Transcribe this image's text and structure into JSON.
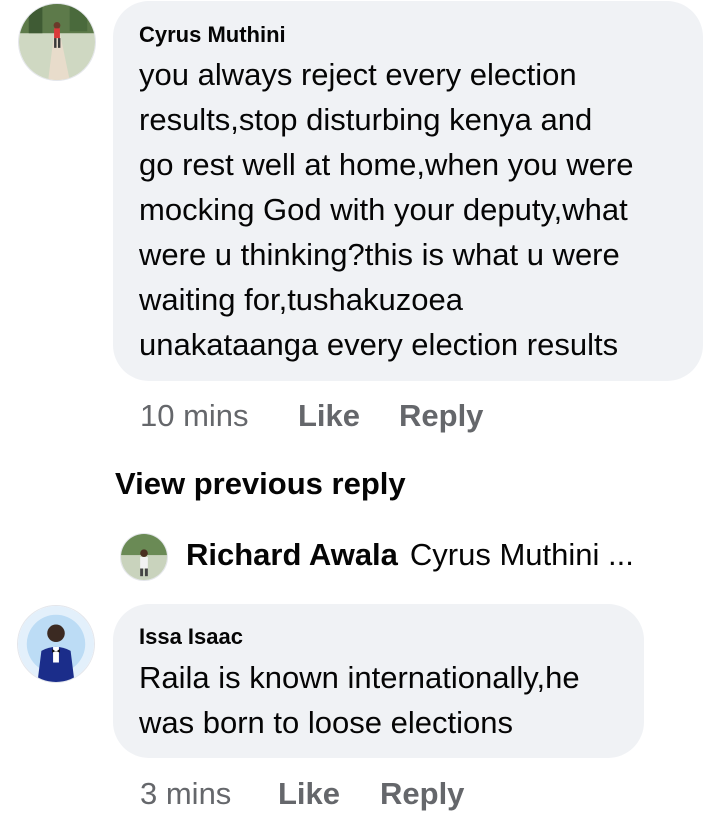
{
  "comments": [
    {
      "author": "Cyrus Muthini",
      "text": "you always reject every election\nresults,stop disturbing kenya and\ngo rest well at home,when you were\nmocking God with your deputy,what\nwere u thinking?this is what u were\nwaiting for,tushakuzoea\nunakataanga every election results",
      "time": "10 mins",
      "like_label": "Like",
      "reply_label": "Reply"
    },
    {
      "author": "Issa Isaac",
      "text": "Raila is known internationally,he\nwas born to loose elections",
      "time": "3 mins",
      "like_label": "Like",
      "reply_label": "Reply"
    }
  ],
  "view_previous_label": "View previous reply",
  "reply_preview": {
    "author": "Richard Awala",
    "snippet": "Cyrus Muthini ..."
  },
  "colors": {
    "bubble": "#f0f2f5",
    "text": "#050505",
    "meta": "#65676b"
  },
  "icons": [
    "avatar-cyrus",
    "avatar-richard",
    "avatar-issa"
  ]
}
